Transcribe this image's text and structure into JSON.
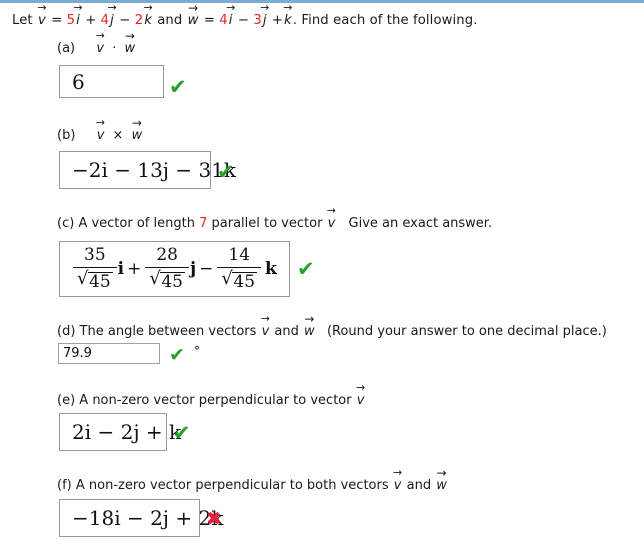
{
  "prompt": {
    "lead": "Let",
    "v_symbol": "v",
    "v_equals": "=",
    "v_c1": "5",
    "v_i": "i",
    "v_plus": "+",
    "v_c2": "4",
    "v_j": "j",
    "v_minus": "−",
    "v_c3": "2",
    "v_k": "k",
    "and": "and",
    "w_symbol": "w",
    "w_equals": "=",
    "w_c1": "4",
    "w_i": "i",
    "w_minus": "−",
    "w_c2": "3",
    "w_j": "j",
    "w_plus": "+",
    "w_k": "k",
    "tail": ".  Find each of the following."
  },
  "colors": {
    "coefficient_red": "#e8242a",
    "correct_green": "#2aa02a",
    "incorrect_red": "#e8203c",
    "top_rule_blue": "#7aaed0",
    "box_border": "#9a9a9a"
  },
  "parts": {
    "a": {
      "label": "(a)",
      "expression_left": "v",
      "operator": "·",
      "expression_right": "w",
      "answer": "6",
      "status": "correct",
      "status_icon": "green-check-icon"
    },
    "b": {
      "label": "(b)",
      "expression_left": "v",
      "operator": "×",
      "expression_right": "w",
      "answer_terms": [
        {
          "sign": "−",
          "coefficient": "2",
          "unit": "i"
        },
        {
          "sign": "−",
          "coefficient": "13",
          "unit": "j"
        },
        {
          "sign": "−",
          "coefficient": "31",
          "unit": "k"
        }
      ],
      "answer_text": "−2i − 13j − 31k",
      "status": "correct",
      "status_icon": "green-check-icon"
    },
    "c": {
      "label": "(c)",
      "text_before": "A vector of length",
      "length_value": "7",
      "text_middle": "parallel to vector",
      "vector": "v",
      "text_after": "Give an exact answer.",
      "answer_terms": [
        {
          "sign": "",
          "numerator": "35",
          "denominator": "45",
          "unit": "i"
        },
        {
          "sign": "+",
          "numerator": "28",
          "denominator": "45",
          "unit": "j"
        },
        {
          "sign": "−",
          "numerator": "14",
          "denominator": "45",
          "unit": "k"
        }
      ],
      "answer_text": "35/√45 i + 28/√45 j − 14/√45 k",
      "status": "correct",
      "status_icon": "green-check-icon"
    },
    "d": {
      "label": "(d)",
      "text_before": "The angle between vectors",
      "vector_1": "v",
      "text_and": "and",
      "vector_2": "w",
      "text_after": "(Round your answer to one decimal place.)",
      "answer": "79.9",
      "unit": "°",
      "status": "correct",
      "status_icon": "green-check-icon"
    },
    "e": {
      "label": "(e)",
      "text_before": "A non-zero vector perpendicular to vector",
      "vector": "v",
      "answer_terms": [
        {
          "sign": "",
          "coefficient": "2",
          "unit": "i"
        },
        {
          "sign": "−",
          "coefficient": "2",
          "unit": "j"
        },
        {
          "sign": "+",
          "coefficient": "",
          "unit": "k"
        }
      ],
      "answer_text": "2i − 2j + k",
      "status": "correct",
      "status_icon": "green-check-icon"
    },
    "f": {
      "label": "(f)",
      "text_before": "A non-zero vector perpendicular to both vectors",
      "vector_1": "v",
      "text_and": "and",
      "vector_2": "w",
      "answer_terms": [
        {
          "sign": "−",
          "coefficient": "18",
          "unit": "i"
        },
        {
          "sign": "−",
          "coefficient": "2",
          "unit": "j"
        },
        {
          "sign": "+",
          "coefficient": "2",
          "unit": "k"
        }
      ],
      "answer_text": "−18i − 2j + 2k",
      "status": "incorrect",
      "status_icon": "red-cross-icon"
    }
  },
  "icons": {
    "check": "✔",
    "cross": "✖"
  }
}
